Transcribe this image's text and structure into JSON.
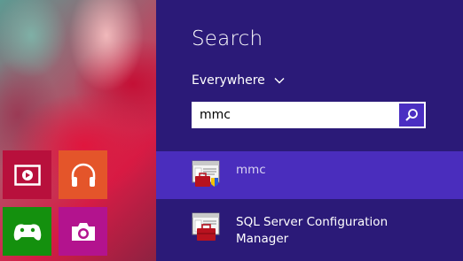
{
  "search_pane": {
    "title": "Search",
    "scope_label": "Everywhere",
    "query": "mmc"
  },
  "results": [
    {
      "lines": [
        "mmc"
      ],
      "icon": "mmc-console-icon",
      "selected": true
    },
    {
      "lines": [
        "SQL Server Configuration",
        "Manager"
      ],
      "icon": "sql-config-manager-icon",
      "selected": false
    }
  ],
  "tiles": [
    {
      "name": "video",
      "icon": "video-icon",
      "color": "#b8103c"
    },
    {
      "name": "music",
      "icon": "headphones-icon",
      "color": "#e4552a"
    },
    {
      "name": "games",
      "icon": "xbox-controller-icon",
      "color": "#14900e"
    },
    {
      "name": "camera",
      "icon": "camera-icon",
      "color": "#b3138e"
    }
  ],
  "colors": {
    "pane_bg": "#2b1a78",
    "selected_bg": "#4a2dbd",
    "search_button": "#4a2ec2"
  }
}
